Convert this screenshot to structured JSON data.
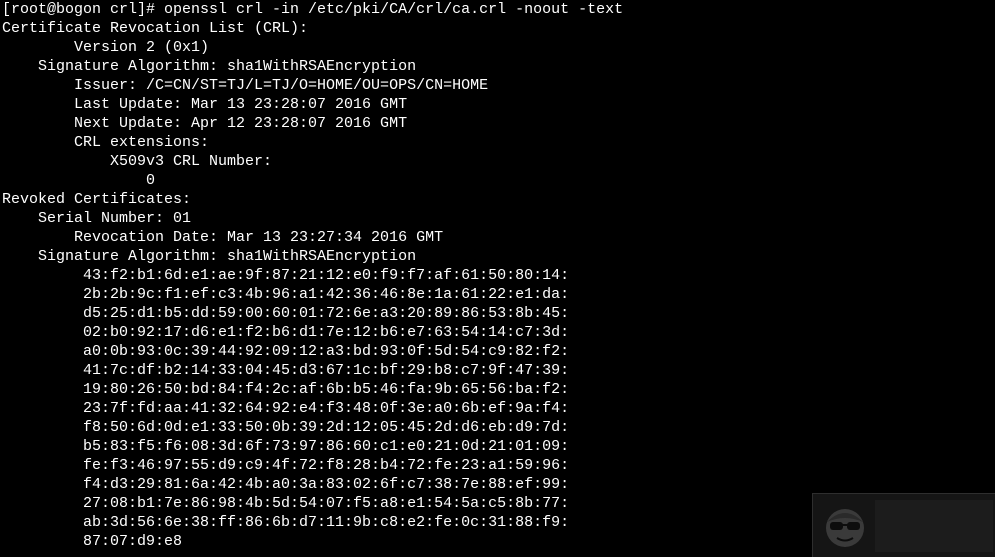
{
  "terminal": {
    "lines": [
      "[root@bogon crl]# openssl crl -in /etc/pki/CA/crl/ca.crl -noout -text",
      "Certificate Revocation List (CRL):",
      "        Version 2 (0x1)",
      "    Signature Algorithm: sha1WithRSAEncryption",
      "        Issuer: /C=CN/ST=TJ/L=TJ/O=HOME/OU=OPS/CN=HOME",
      "        Last Update: Mar 13 23:28:07 2016 GMT",
      "        Next Update: Apr 12 23:28:07 2016 GMT",
      "        CRL extensions:",
      "            X509v3 CRL Number:",
      "                0",
      "Revoked Certificates:",
      "    Serial Number: 01",
      "        Revocation Date: Mar 13 23:27:34 2016 GMT",
      "    Signature Algorithm: sha1WithRSAEncryption",
      "         43:f2:b1:6d:e1:ae:9f:87:21:12:e0:f9:f7:af:61:50:80:14:",
      "         2b:2b:9c:f1:ef:c3:4b:96:a1:42:36:46:8e:1a:61:22:e1:da:",
      "         d5:25:d1:b5:dd:59:00:60:01:72:6e:a3:20:89:86:53:8b:45:",
      "         02:b0:92:17:d6:e1:f2:b6:d1:7e:12:b6:e7:63:54:14:c7:3d:",
      "         a0:0b:93:0c:39:44:92:09:12:a3:bd:93:0f:5d:54:c9:82:f2:",
      "         41:7c:df:b2:14:33:04:45:d3:67:1c:bf:29:b8:c7:9f:47:39:",
      "         19:80:26:50:bd:84:f4:2c:af:6b:b5:46:fa:9b:65:56:ba:f2:",
      "         23:7f:fd:aa:41:32:64:92:e4:f3:48:0f:3e:a0:6b:ef:9a:f4:",
      "         f8:50:6d:0d:e1:33:50:0b:39:2d:12:05:45:2d:d6:eb:d9:7d:",
      "         b5:83:f5:f6:08:3d:6f:73:97:86:60:c1:e0:21:0d:21:01:09:",
      "         fe:f3:46:97:55:d9:c9:4f:72:f8:28:b4:72:fe:23:a1:59:96:",
      "         f4:d3:29:81:6a:42:4b:a0:3a:83:02:6f:c7:38:7e:88:ef:99:",
      "         27:08:b1:7e:86:98:4b:5d:54:07:f5:a8:e1:54:5a:c5:8b:77:",
      "         ab:3d:56:6e:38:ff:86:6b:d7:11:9b:c8:e2:fe:0c:31:88:f9:",
      "         87:07:d9:e8"
    ]
  },
  "colors": {
    "background": "#000000",
    "foreground": "#ffffff"
  },
  "watermark": {
    "icon": "cartoon-face-sunglasses-icon"
  }
}
